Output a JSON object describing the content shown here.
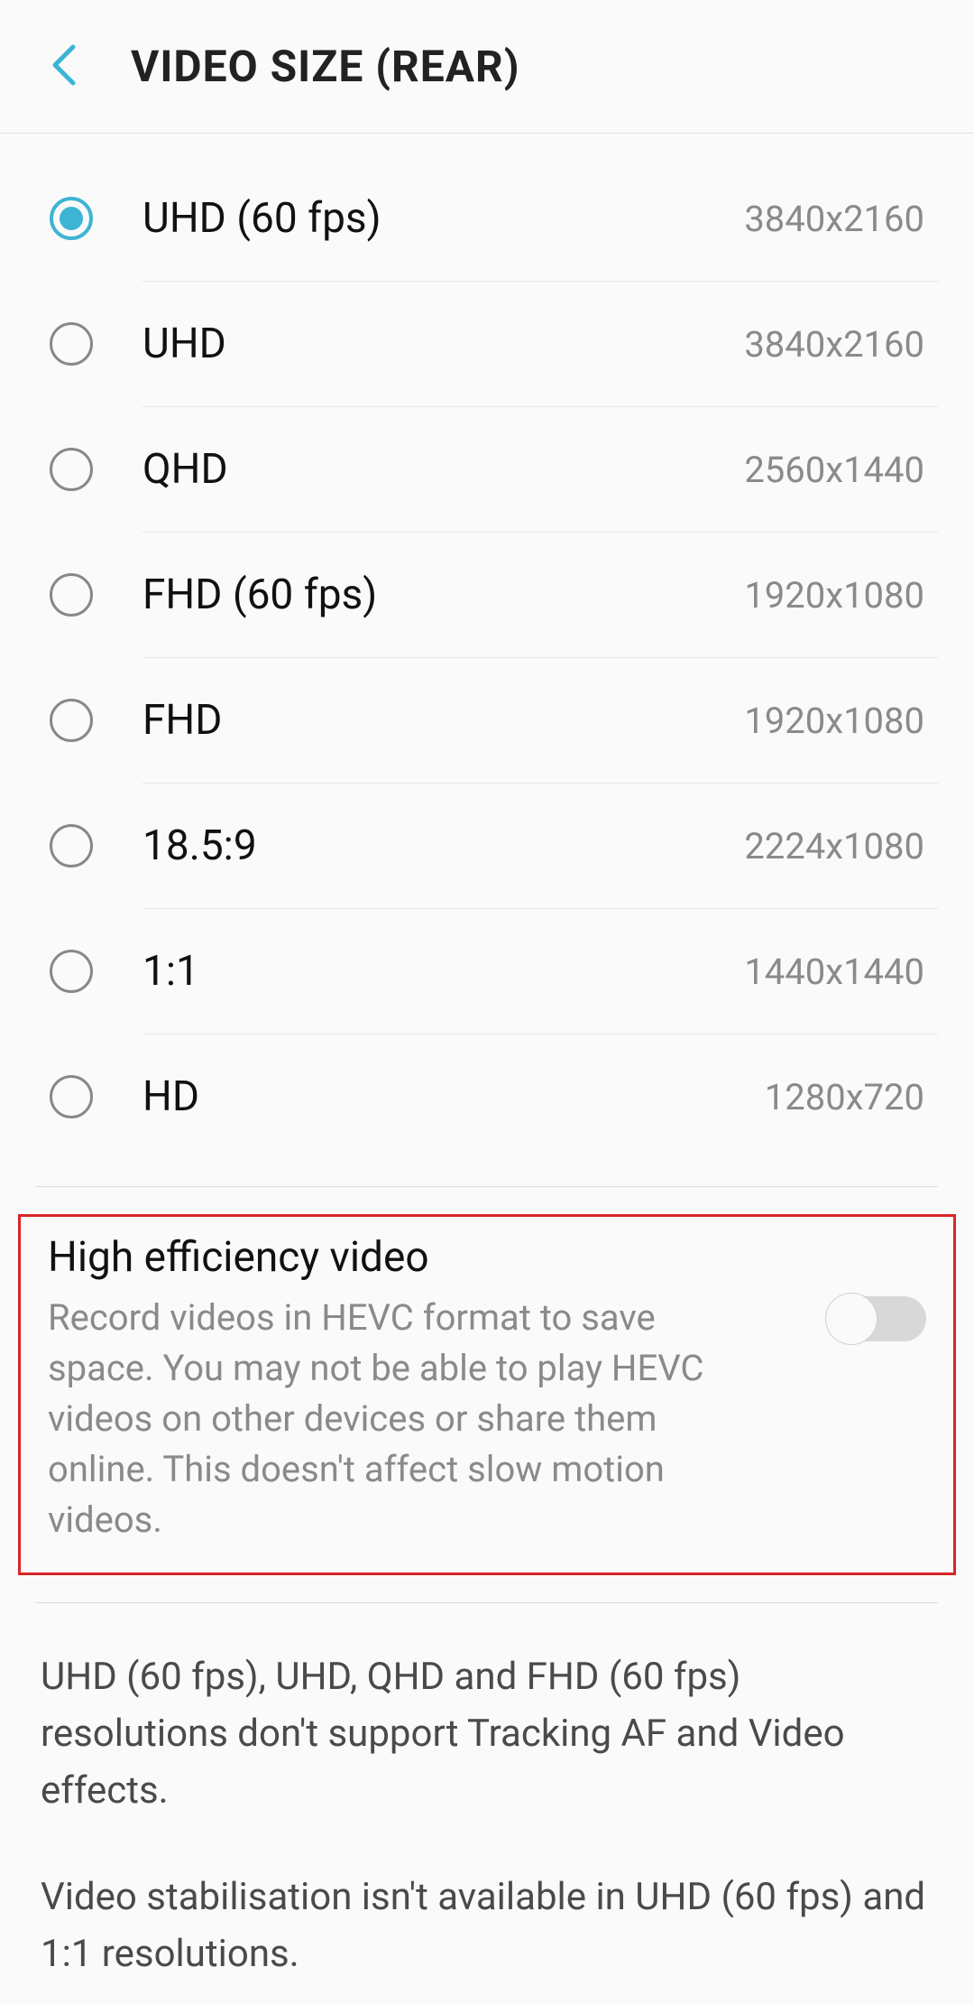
{
  "header": {
    "title": "VIDEO SIZE (REAR)"
  },
  "selected_index": 0,
  "options": [
    {
      "label": "UHD (60 fps)",
      "resolution": "3840x2160"
    },
    {
      "label": "UHD",
      "resolution": "3840x2160"
    },
    {
      "label": "QHD",
      "resolution": "2560x1440"
    },
    {
      "label": "FHD (60 fps)",
      "resolution": "1920x1080"
    },
    {
      "label": "FHD",
      "resolution": "1920x1080"
    },
    {
      "label": "18.5:9",
      "resolution": "2224x1080"
    },
    {
      "label": "1:1",
      "resolution": "1440x1440"
    },
    {
      "label": "HD",
      "resolution": "1280x720"
    }
  ],
  "toggle": {
    "title": "High efficiency video",
    "description": "Record videos in HEVC format to save space. You may not be able to play HEVC videos on other devices or share them online. This doesn't affect slow motion videos.",
    "enabled": false
  },
  "info": {
    "paragraph1": "UHD (60 fps), UHD, QHD and FHD (60 fps) resolutions don't support Tracking AF and Video effects.",
    "paragraph2": "Video stabilisation isn't available in UHD (60 fps) and 1:1 resolutions."
  }
}
